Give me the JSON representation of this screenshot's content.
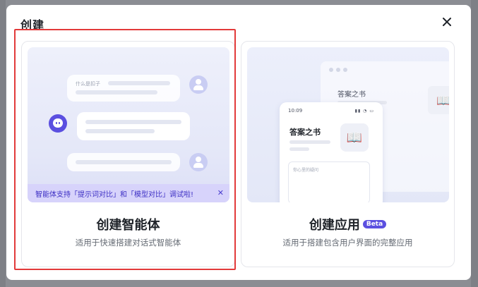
{
  "dialog": {
    "title": "创建",
    "close_icon": "close-icon"
  },
  "agent_card": {
    "title": "创建智能体",
    "subtitle": "适用于快速搭建对话式智能体",
    "notice": "智能体支持「提示词对比」和「模型对比」调试啦!",
    "notice_close": "✕",
    "chat_question": "什么是扣子"
  },
  "app_card": {
    "title": "创建应用",
    "badge": "Beta",
    "subtitle": "适用于搭建包含用户界面的完整应用",
    "window_title": "答案之书",
    "phone_time": "10:09",
    "phone_title": "答案之书",
    "input_placeholder": "你心里的疑问"
  },
  "colors": {
    "accent": "#5b4fe0",
    "highlight": "#e23a3a"
  }
}
